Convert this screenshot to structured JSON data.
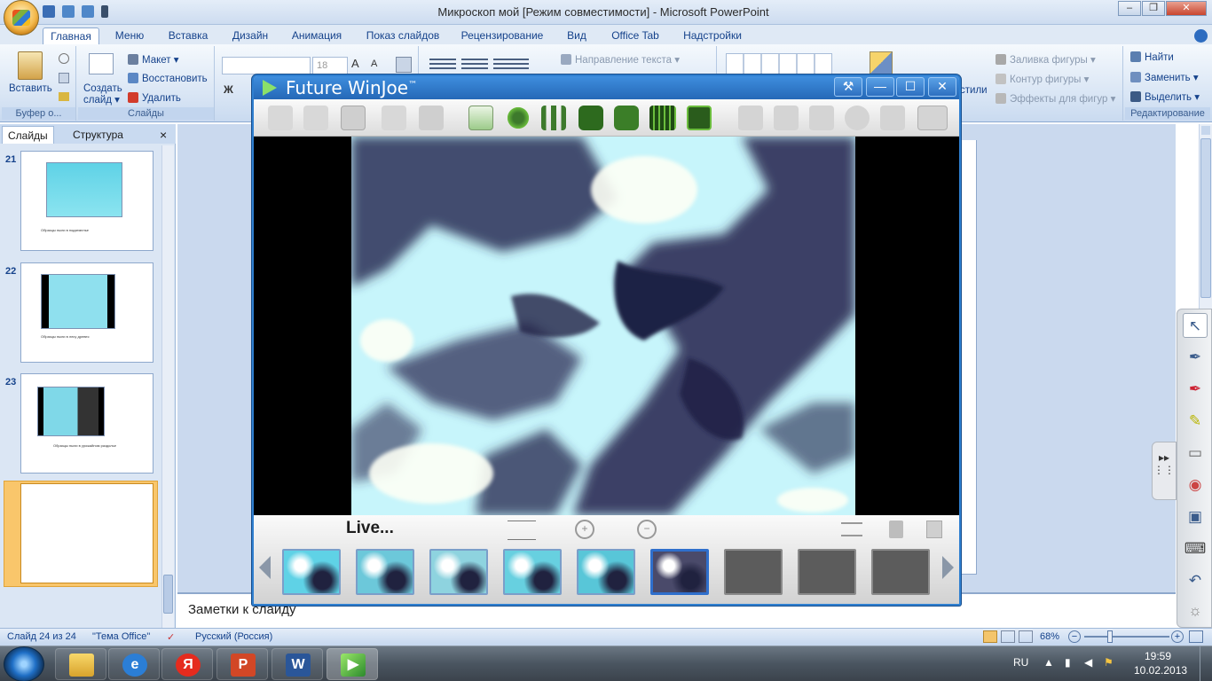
{
  "window": {
    "title": "Микроскоп мой [Режим совместимости] - Microsoft PowerPoint",
    "controls": [
      "–",
      "❐",
      "✕"
    ]
  },
  "qat": {
    "icons": [
      "save-icon",
      "undo-icon",
      "redo-icon",
      "customize-icon"
    ]
  },
  "ribbon": {
    "tabs": [
      "Главная",
      "Меню",
      "Вставка",
      "Дизайн",
      "Анимация",
      "Показ слайдов",
      "Рецензирование",
      "Вид",
      "Office Tab",
      "Надстройки"
    ],
    "active_tab": "Главная",
    "clipboard": {
      "paste": "Вставить",
      "label": "Буфер о..."
    },
    "slides": {
      "create": "Создать слайд ▾",
      "layout": "Макет ▾",
      "reset": "Восстановить",
      "delete": "Удалить",
      "label": "Слайды"
    },
    "font": {
      "size": "18",
      "bold": "Ж"
    },
    "paragraph": {
      "text_direction": "Направление текста ▾"
    },
    "drawing": {
      "fill": "Заливка фигуры ▾",
      "outline": "Контур фигуры ▾",
      "effects": "Эффекты для фигур ▾",
      "styles": "стили"
    },
    "editing": {
      "find": "Найти",
      "replace": "Заменить ▾",
      "select": "Выделить ▾",
      "label": "Редактирование"
    }
  },
  "slide_panel": {
    "tabs": [
      "Слайды",
      "Структура"
    ],
    "close": "×",
    "slides": [
      {
        "number": "21",
        "caption": "Образцы пыли в подземелье"
      },
      {
        "number": "22",
        "caption": "Образцы пыли в лесу древес"
      },
      {
        "number": "23",
        "caption": "Образцы пыли в урожайном раздолье"
      },
      {
        "number": "24",
        "caption": ""
      }
    ]
  },
  "notes": {
    "placeholder": "Заметки к слайду"
  },
  "status": {
    "slide": "Слайд 24 из 24",
    "theme": "\"Тема Office\"",
    "language": "Русский (Россия)",
    "zoom": "68%"
  },
  "winjoe": {
    "title": "Future WinJoe",
    "trademark": "™",
    "toolbar_icons": [
      "new-icon",
      "open-icon",
      "save-as-icon",
      "folder-icon",
      "disk-icon",
      "camera-source-icon",
      "settings-gear-icon",
      "adjust-icon",
      "snapshot-icon",
      "multi-snapshot-icon",
      "record-video-icon",
      "monitor-icon",
      "export-icon",
      "resize-icon",
      "crop-icon",
      "brightness-icon",
      "email-icon",
      "print-icon"
    ],
    "status": "Live...",
    "captures": [
      {
        "kind": "image",
        "color": "#5fd2e6"
      },
      {
        "kind": "image",
        "color": "#6cc8da"
      },
      {
        "kind": "image",
        "color": "#8ed3df"
      },
      {
        "kind": "image",
        "color": "#67d0e0"
      },
      {
        "kind": "image",
        "color": "#58c6d8"
      },
      {
        "kind": "image",
        "color": "#4a4a6a",
        "selected": true
      },
      {
        "kind": "empty"
      },
      {
        "kind": "empty"
      },
      {
        "kind": "empty"
      }
    ]
  },
  "taskbar": {
    "apps": [
      "file-explorer-icon",
      "internet-explorer-icon",
      "yandex-icon",
      "powerpoint-icon",
      "word-icon",
      "winjoe-icon"
    ],
    "language": "RU",
    "time": "19:59",
    "date": "10.02.2013"
  },
  "colors": {
    "accent": "#2f7fd0",
    "ribbon": "#dfe9f5",
    "sample_cyan": "#aef0fb",
    "sample_dark": "#2b2d4e"
  }
}
